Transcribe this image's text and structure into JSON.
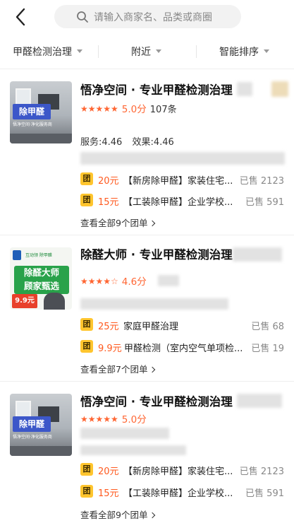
{
  "header": {
    "back_icon": "chevron-left-icon",
    "search_icon": "search-icon",
    "search_placeholder": "请输入商家名、品类或商圈"
  },
  "filters": [
    {
      "label": "甲醛检测治理"
    },
    {
      "label": "附近"
    },
    {
      "label": "智能排序"
    }
  ],
  "colors": {
    "accent": "#ff6633",
    "tuan_badge": "#ffc52e",
    "price": "#ff5a1f"
  },
  "shops": [
    {
      "name": "悟净空间 · 专业甲醛检测治理",
      "stars": "★★★★★",
      "rating": 5.0,
      "score_text": "5.0分",
      "reviews": "107条",
      "service": "服务:4.46",
      "effect": "效果:4.46",
      "thumb_badge": "除甲醛",
      "thumb_caption": "悟净空间·净化服务商",
      "deals": [
        {
          "tag": "团",
          "price": "20元",
          "title": "【新房除甲醛】家装住宅...",
          "sold": "已售 2123"
        },
        {
          "tag": "团",
          "price": "15元",
          "title": "【工装除甲醛】企业学校...",
          "sold": "已售 591"
        }
      ],
      "more": "查看全部9个团单"
    },
    {
      "name": "除醛大师 · 专业甲醛检测治理",
      "stars": "★★★★☆",
      "rating": 4.6,
      "score_text": "4.6分",
      "thumb_top": "互动领 除甲醛",
      "thumb_big_1": "除醛大师",
      "thumb_big_2": "顾家甄选",
      "thumb_price": "9.9元",
      "deals": [
        {
          "tag": "团",
          "price": "25元",
          "title": "家庭甲醛治理",
          "sold": "已售 68"
        },
        {
          "tag": "团",
          "price": "9.9元",
          "title": "甲醛检测（室内空气单项检...",
          "sold": "已售 19"
        }
      ],
      "more": "查看全部7个团单"
    },
    {
      "name": "悟净空间 · 专业甲醛检测治理",
      "stars": "★★★★★",
      "rating": 5.0,
      "score_text": "5.0分",
      "thumb_badge": "除甲醛",
      "thumb_caption": "悟净空间·净化服务商",
      "deals": [
        {
          "tag": "团",
          "price": "20元",
          "title": "【新房除甲醛】家装住宅...",
          "sold": "已售 2123"
        },
        {
          "tag": "团",
          "price": "15元",
          "title": "【工装除甲醛】企业学校...",
          "sold": "已售 591"
        }
      ],
      "more": "查看全部9个团单"
    }
  ]
}
